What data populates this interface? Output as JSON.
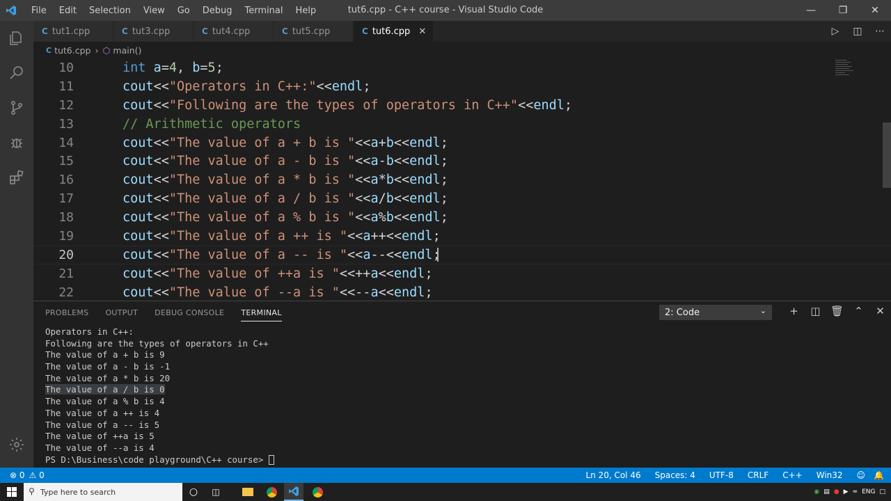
{
  "window": {
    "title": "tut6.cpp - C++ course - Visual Studio Code"
  },
  "menu": [
    "File",
    "Edit",
    "Selection",
    "View",
    "Go",
    "Debug",
    "Terminal",
    "Help"
  ],
  "tabs": [
    {
      "label": "tut1.cpp",
      "active": false
    },
    {
      "label": "tut3.cpp",
      "active": false
    },
    {
      "label": "tut4.cpp",
      "active": false
    },
    {
      "label": "tut5.cpp",
      "active": false
    },
    {
      "label": "tut6.cpp",
      "active": true
    }
  ],
  "breadcrumb": {
    "file": "tut6.cpp",
    "symbol": "main()"
  },
  "code_lines": [
    {
      "n": "10",
      "text": "int a=4, b=5;"
    },
    {
      "n": "11",
      "text": "cout<<\"Operators in C++:\"<<endl;"
    },
    {
      "n": "12",
      "text": "cout<<\"Following are the types of operators in C++\"<<endl;"
    },
    {
      "n": "13",
      "text": "// Arithmetic operators"
    },
    {
      "n": "14",
      "text": "cout<<\"The value of a + b is \"<<a+b<<endl;"
    },
    {
      "n": "15",
      "text": "cout<<\"The value of a - b is \"<<a-b<<endl;"
    },
    {
      "n": "16",
      "text": "cout<<\"The value of a * b is \"<<a*b<<endl;"
    },
    {
      "n": "17",
      "text": "cout<<\"The value of a / b is \"<<a/b<<endl;"
    },
    {
      "n": "18",
      "text": "cout<<\"The value of a % b is \"<<a%b<<endl;"
    },
    {
      "n": "19",
      "text": "cout<<\"The value of a ++ is \"<<a++<<endl;"
    },
    {
      "n": "20",
      "text": "cout<<\"The value of a -- is \"<<a--<<endl;"
    },
    {
      "n": "21",
      "text": "cout<<\"The value of ++a is \"<<++a<<endl;"
    },
    {
      "n": "22",
      "text": "cout<<\"The value of --a is \"<<--a<<endl;"
    }
  ],
  "panel": {
    "tabs": [
      "PROBLEMS",
      "OUTPUT",
      "DEBUG CONSOLE",
      "TERMINAL"
    ],
    "active_tab": "TERMINAL",
    "terminal_select": "2: Code"
  },
  "terminal_lines": [
    "Operators in C++:",
    "Following are the types of operators in C++",
    "The value of a + b is 9",
    "The value of a - b is -1",
    "The value of a * b is 20",
    "The value of a / b is 0",
    "The value of a % b is 4",
    "The value of a ++ is 4",
    "The value of a -- is 5",
    "The value of ++a is 5",
    "The value of --a is 4"
  ],
  "terminal_prompt": "PS D:\\Business\\code playground\\C++ course> ",
  "status": {
    "errors": "0",
    "warnings": "0",
    "position": "Ln 20, Col 46",
    "spaces": "Spaces: 4",
    "encoding": "UTF-8",
    "eol": "CRLF",
    "language": "C++",
    "platform": "Win32"
  },
  "taskbar": {
    "search_placeholder": "Type here to search",
    "lang": "ENG"
  }
}
